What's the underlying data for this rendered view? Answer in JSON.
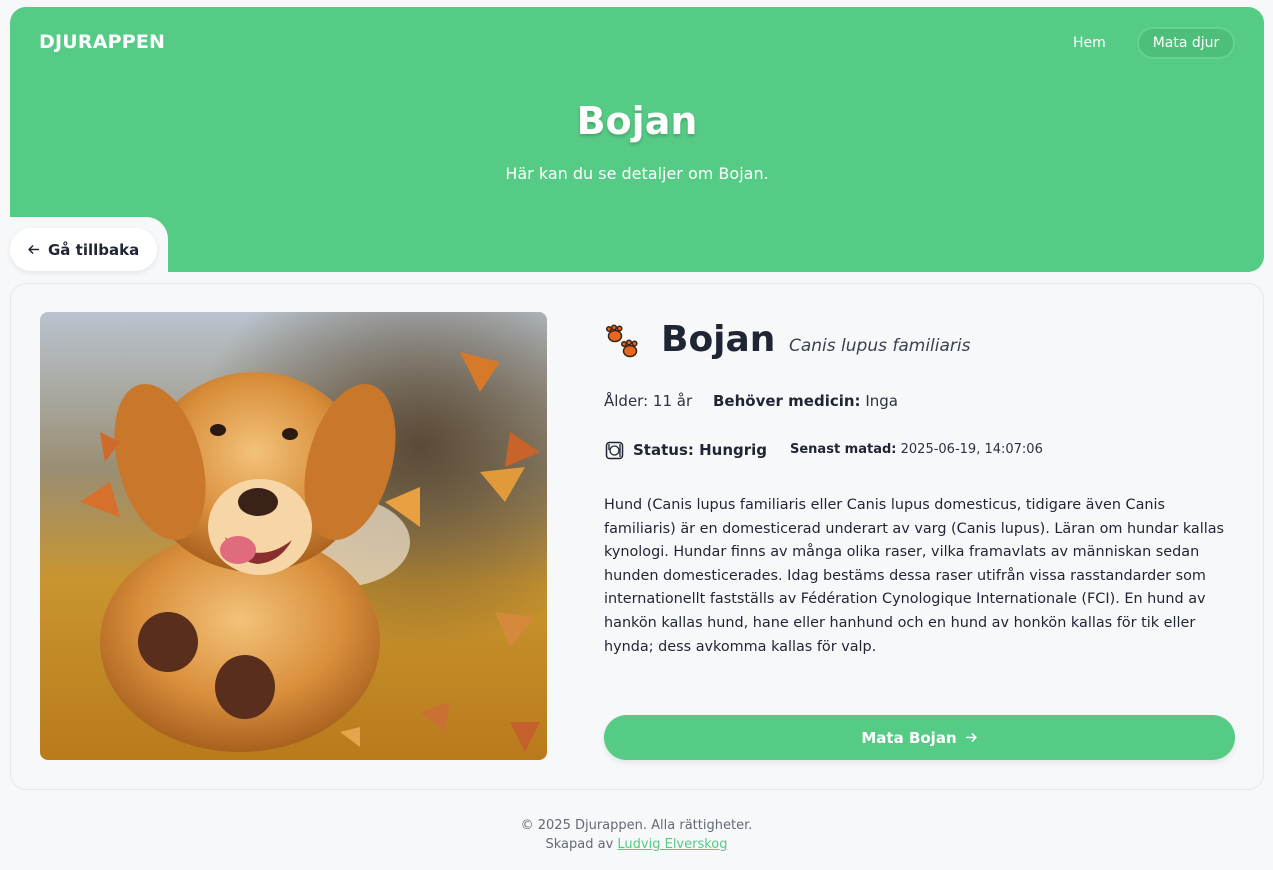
{
  "header": {
    "logo": "DJURAPPEN",
    "nav": {
      "home": "Hem",
      "feed": "Mata djur"
    },
    "title": "Bojan",
    "subtitle": "Här kan du se detaljer om Bojan.",
    "back_label": "Gå tillbaka"
  },
  "animal": {
    "name": "Bojan",
    "scientific_name": "Canis lupus familiaris",
    "age": "Ålder: 11 år",
    "medicine_label": "Behöver medicin:",
    "medicine_value": "Inga",
    "status": "Status: Hungrig",
    "last_fed_label": "Senast matad:",
    "last_fed_value": "2025-06-19, 14:07:06",
    "description": "Hund (Canis lupus familiaris eller Canis lupus domesticus, tidigare även Canis familiaris) är en domesticerad underart av varg (Canis lupus). Läran om hundar kallas kynologi. Hundar finns av många olika raser, vilka framavlats av människan sedan hunden domesticerades. Idag bestäms dessa raser utifrån vissa rasstandarder som internationellt fastställs av Fédération Cynologique Internationale (FCI). En hund av hankön kallas hund, hane eller hanhund och en hund av honkön kallas för tik eller hynda; dess avkomma kallas för valp.",
    "feed_button": "Mata Bojan",
    "photo_icon": "dog-photo"
  },
  "footer": {
    "copyright": "© 2025 Djurappen. Alla rättigheter.",
    "created_by": "Skapad av",
    "author": "Ludvig Elverskog"
  },
  "colors": {
    "accent": "#55cb85",
    "background": "#f7f8f9",
    "text": "#1f2533"
  }
}
